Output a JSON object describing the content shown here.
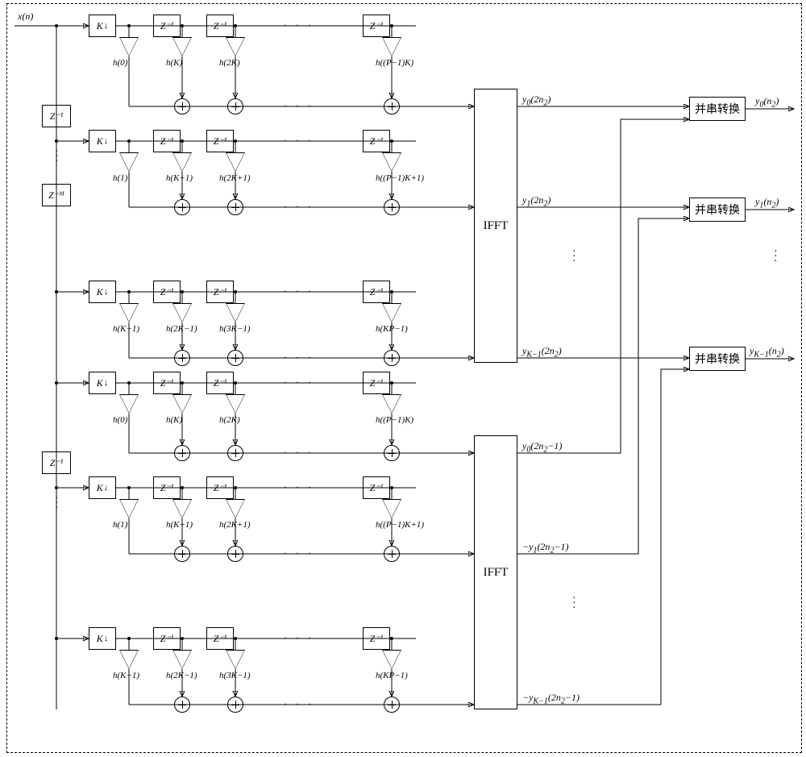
{
  "input_signal": "x(n)",
  "delay_label": "Z⁻¹",
  "delay_M_label": "Z⁻ᴹ",
  "decimator_label": "K",
  "ifft_label": "IFFT",
  "ps_label": "并串转换",
  "branches_top": [
    {
      "coeffs": [
        "h(0)",
        "h(K)",
        "h(2K)",
        "h((P−1)K)"
      ],
      "out_label": "y₀(2n₂)"
    },
    {
      "coeffs": [
        "h(1)",
        "h(K+1)",
        "h(2K+1)",
        "h((P−1)K+1)"
      ],
      "out_label": "y₁(2n₂)"
    },
    {
      "coeffs": [
        "h(K−1)",
        "h(2K−1)",
        "h(3K−1)",
        "h(KP−1)"
      ],
      "out_label": "y_{K−1}(2n₂)"
    }
  ],
  "branches_bottom": [
    {
      "coeffs": [
        "h(0)",
        "h(K)",
        "h(2K)",
        "h((P−1)K)"
      ],
      "out_label": "y₀(2n₂−1)"
    },
    {
      "coeffs": [
        "h(1)",
        "h(K+1)",
        "h(2K+1)",
        "h((P−1)K+1)"
      ],
      "out_label": "−y₁(2n₂−1)"
    },
    {
      "coeffs": [
        "h(K−1)",
        "h(2K−1)",
        "h(3K−1)",
        "h(KP−1)"
      ],
      "out_label": "−y_{K−1}(2n₂−1)"
    }
  ],
  "output_labels": [
    "y₀(n₂)",
    "y₁(n₂)",
    "y_{K−1}(n₂)"
  ],
  "chart_data": {
    "type": "block-diagram",
    "description": "Polyphase channelizer with K branches (each branch decimates by K then passes through an FIR filter of P taps with coefficients h(mK+i), i=0..K−1, m=0..P−1). Two parallel polyphase banks (offset by M samples via Z^{-M}) each feed a K-point IFFT producing even-indexed and odd-indexed output samples y_k(2n₂) and ±y_k(2n₂−1). Each pair is interleaved by a parallel-to-serial converter to yield y_k(n₂).",
    "blocks": {
      "polyphase_bank": {
        "num_branches": "K",
        "per_branch": [
          "↓K decimator",
          "P-tap FIR (coeffs h(i), h(K+i), ..., h((P−1)K+i))"
        ]
      },
      "input_delay_chain": [
        "Z^{-1} (between top branches)",
        "Z^{-M} (between top-bank and bottom-bank inputs)",
        "Z^{-1} (between bottom branches)"
      ],
      "ifft": {
        "size": "K",
        "count": 2
      },
      "parallel_to_serial": {
        "count": "K",
        "inputs_each": 2
      }
    },
    "top_ifft_outputs": [
      "y₀(2n₂)",
      "y₁(2n₂)",
      "…",
      "y_{K−1}(2n₂)"
    ],
    "bottom_ifft_outputs": [
      "y₀(2n₂−1)",
      "−y₁(2n₂−1)",
      "…",
      "−y_{K−1}(2n₂−1)"
    ],
    "final_outputs": [
      "y₀(n₂)",
      "y₁(n₂)",
      "…",
      "y_{K−1}(n₂)"
    ]
  }
}
